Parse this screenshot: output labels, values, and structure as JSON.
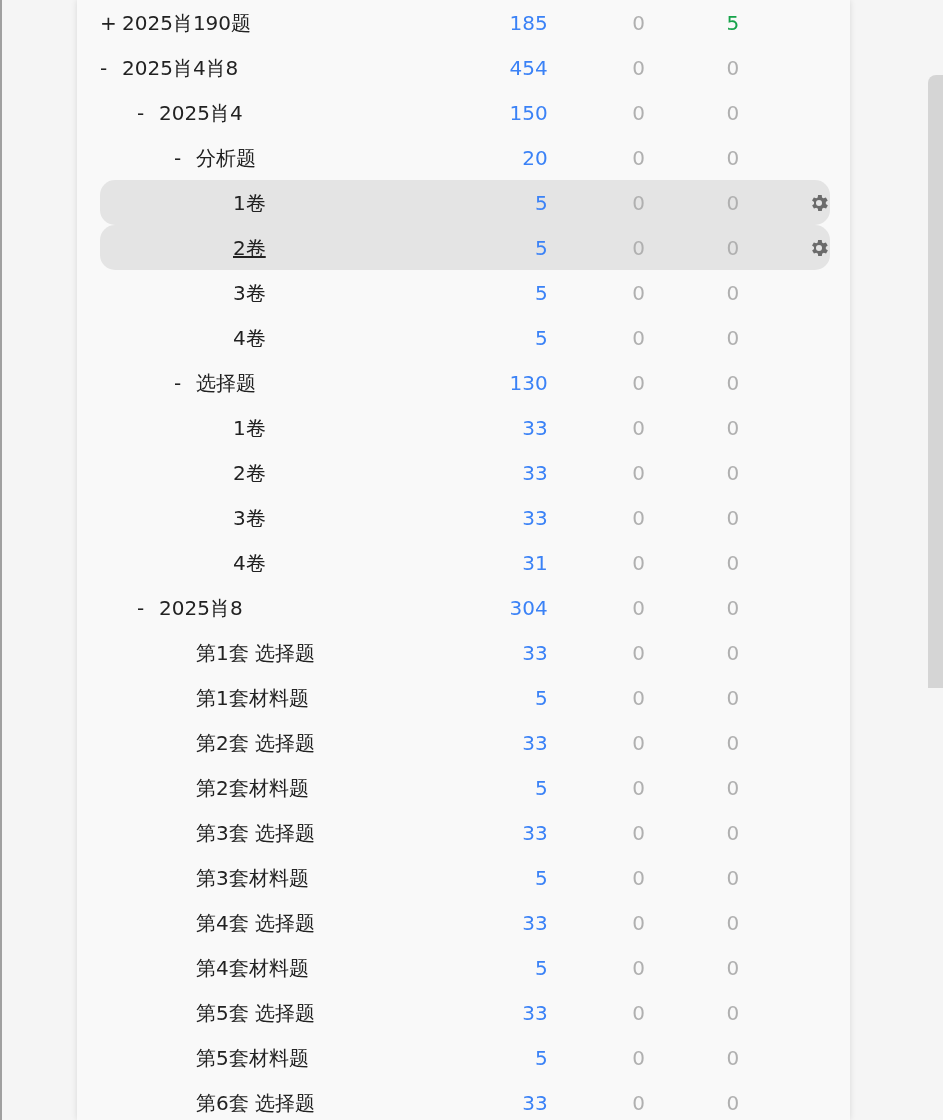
{
  "tree": [
    {
      "toggle": "+",
      "label": "2025肖190题",
      "total": "185",
      "col2": "0",
      "col3": "5",
      "accent": true,
      "highlighted": false,
      "hovered": false
    },
    {
      "toggle": "-",
      "label": "2025肖4肖8",
      "total": "454",
      "col2": "0",
      "col3": "0",
      "accent": false,
      "highlighted": false,
      "hovered": false,
      "children": [
        {
          "toggle": "-",
          "label": "2025肖4",
          "total": "150",
          "col2": "0",
          "col3": "0",
          "accent": false,
          "highlighted": false,
          "hovered": false,
          "children": [
            {
              "toggle": "-",
              "label": "分析题",
              "total": "20",
              "col2": "0",
              "col3": "0",
              "accent": false,
              "highlighted": false,
              "hovered": false,
              "children": [
                {
                  "label": "1卷",
                  "total": "5",
                  "col2": "0",
                  "col3": "0",
                  "accent": false,
                  "highlighted": true,
                  "hovered": false
                },
                {
                  "label": "2卷",
                  "total": "5",
                  "col2": "0",
                  "col3": "0",
                  "accent": false,
                  "highlighted": true,
                  "hovered": true
                },
                {
                  "label": "3卷",
                  "total": "5",
                  "col2": "0",
                  "col3": "0",
                  "accent": false,
                  "highlighted": false,
                  "hovered": false
                },
                {
                  "label": "4卷",
                  "total": "5",
                  "col2": "0",
                  "col3": "0",
                  "accent": false,
                  "highlighted": false,
                  "hovered": false
                }
              ]
            },
            {
              "toggle": "-",
              "label": "选择题",
              "total": "130",
              "col2": "0",
              "col3": "0",
              "accent": false,
              "highlighted": false,
              "hovered": false,
              "children": [
                {
                  "label": "1卷",
                  "total": "33",
                  "col2": "0",
                  "col3": "0",
                  "accent": false,
                  "highlighted": false,
                  "hovered": false
                },
                {
                  "label": "2卷",
                  "total": "33",
                  "col2": "0",
                  "col3": "0",
                  "accent": false,
                  "highlighted": false,
                  "hovered": false
                },
                {
                  "label": "3卷",
                  "total": "33",
                  "col2": "0",
                  "col3": "0",
                  "accent": false,
                  "highlighted": false,
                  "hovered": false
                },
                {
                  "label": "4卷",
                  "total": "31",
                  "col2": "0",
                  "col3": "0",
                  "accent": false,
                  "highlighted": false,
                  "hovered": false
                }
              ]
            }
          ]
        },
        {
          "toggle": "-",
          "label": "2025肖8",
          "total": "304",
          "col2": "0",
          "col3": "0",
          "accent": false,
          "highlighted": false,
          "hovered": false,
          "children": [
            {
              "label": "第1套 选择题",
              "total": "33",
              "col2": "0",
              "col3": "0",
              "accent": false,
              "highlighted": false,
              "hovered": false
            },
            {
              "label": "第1套材料题",
              "total": "5",
              "col2": "0",
              "col3": "0",
              "accent": false,
              "highlighted": false,
              "hovered": false
            },
            {
              "label": "第2套 选择题",
              "total": "33",
              "col2": "0",
              "col3": "0",
              "accent": false,
              "highlighted": false,
              "hovered": false
            },
            {
              "label": "第2套材料题",
              "total": "5",
              "col2": "0",
              "col3": "0",
              "accent": false,
              "highlighted": false,
              "hovered": false
            },
            {
              "label": "第3套 选择题",
              "total": "33",
              "col2": "0",
              "col3": "0",
              "accent": false,
              "highlighted": false,
              "hovered": false
            },
            {
              "label": "第3套材料题",
              "total": "5",
              "col2": "0",
              "col3": "0",
              "accent": false,
              "highlighted": false,
              "hovered": false
            },
            {
              "label": "第4套 选择题",
              "total": "33",
              "col2": "0",
              "col3": "0",
              "accent": false,
              "highlighted": false,
              "hovered": false
            },
            {
              "label": "第4套材料题",
              "total": "5",
              "col2": "0",
              "col3": "0",
              "accent": false,
              "highlighted": false,
              "hovered": false
            },
            {
              "label": "第5套 选择题",
              "total": "33",
              "col2": "0",
              "col3": "0",
              "accent": false,
              "highlighted": false,
              "hovered": false
            },
            {
              "label": "第5套材料题",
              "total": "5",
              "col2": "0",
              "col3": "0",
              "accent": false,
              "highlighted": false,
              "hovered": false
            },
            {
              "label": "第6套 选择题",
              "total": "33",
              "col2": "0",
              "col3": "0",
              "accent": false,
              "highlighted": false,
              "hovered": false
            }
          ]
        }
      ]
    }
  ]
}
